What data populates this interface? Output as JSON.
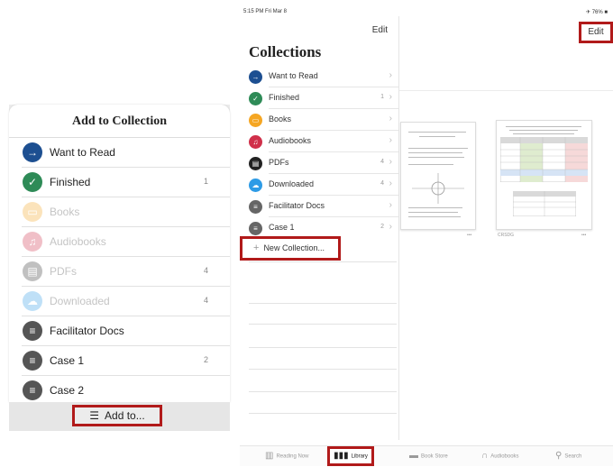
{
  "add_to_collection": {
    "title": "Add to Collection",
    "items": [
      {
        "label": "Want to Read",
        "count": "",
        "icon": "arrow-right-icon",
        "color": "#1d4f91",
        "enabled": true
      },
      {
        "label": "Finished",
        "count": "1",
        "icon": "checkmark-icon",
        "color": "#2e8b57",
        "enabled": true
      },
      {
        "label": "Books",
        "count": "",
        "icon": "book-icon",
        "color": "#f5a623",
        "enabled": false
      },
      {
        "label": "Audiobooks",
        "count": "",
        "icon": "headphones-icon",
        "color": "#d0304a",
        "enabled": false
      },
      {
        "label": "PDFs",
        "count": "4",
        "icon": "document-icon",
        "color": "#333333",
        "enabled": false
      },
      {
        "label": "Downloaded",
        "count": "4",
        "icon": "cloud-download-icon",
        "color": "#2d9be6",
        "enabled": false
      },
      {
        "label": "Facilitator Docs",
        "count": "",
        "icon": "list-icon",
        "color": "#555555",
        "enabled": true
      },
      {
        "label": "Case 1",
        "count": "2",
        "icon": "list-icon",
        "color": "#555555",
        "enabled": true
      },
      {
        "label": "Case 2",
        "count": "",
        "icon": "list-icon",
        "color": "#555555",
        "enabled": true
      }
    ],
    "add_to_label": "Add to..."
  },
  "collections": {
    "status_left": "5:15 PM  Fri Mar 8",
    "status_right": "✈ 76% ■",
    "edit_label": "Edit",
    "title": "Collections",
    "items": [
      {
        "label": "Want to Read",
        "count": "",
        "icon": "arrow-right-icon",
        "color": "#1d4f91"
      },
      {
        "label": "Finished",
        "count": "1",
        "icon": "checkmark-icon",
        "color": "#2e8b57"
      },
      {
        "label": "Books",
        "count": "",
        "icon": "book-icon",
        "color": "#f5a623"
      },
      {
        "label": "Audiobooks",
        "count": "",
        "icon": "headphones-icon",
        "color": "#d0304a"
      },
      {
        "label": "PDFs",
        "count": "4",
        "icon": "document-icon",
        "color": "#222222"
      },
      {
        "label": "Downloaded",
        "count": "4",
        "icon": "cloud-download-icon",
        "color": "#2d9be6"
      },
      {
        "label": "Facilitator Docs",
        "count": "",
        "icon": "list-icon",
        "color": "#666666"
      },
      {
        "label": "Case 1",
        "count": "2",
        "icon": "list-icon",
        "color": "#666666"
      }
    ],
    "new_collection_label": "New Collection..."
  },
  "right": {
    "edit_label": "Edit",
    "thumbnails": [
      {
        "meta_left": "",
        "meta_right": "•••"
      },
      {
        "meta_left": "CRSDG",
        "meta_right": "•••"
      }
    ]
  },
  "tabbar": {
    "tabs": [
      {
        "label": "Reading Now",
        "icon": "open-book-icon"
      },
      {
        "label": "Library",
        "icon": "library-icon"
      },
      {
        "label": "Book Store",
        "icon": "store-icon"
      },
      {
        "label": "Audiobooks",
        "icon": "headphones-icon"
      },
      {
        "label": "Search",
        "icon": "search-icon"
      }
    ]
  },
  "accent_color": "#b11a1a"
}
